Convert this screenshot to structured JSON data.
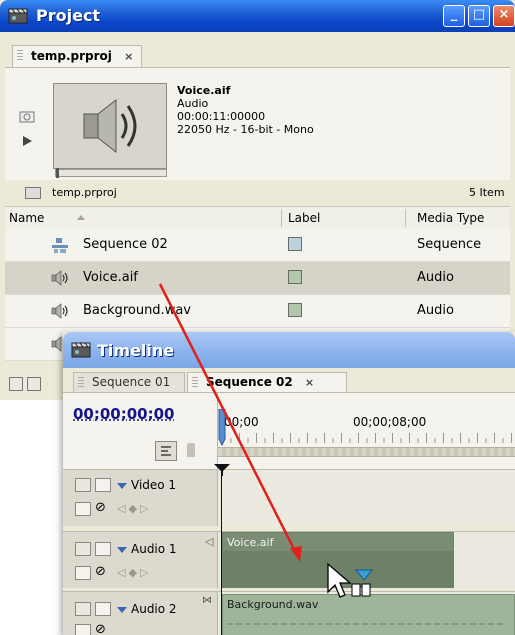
{
  "project": {
    "title": "Project",
    "tab": "temp.prproj",
    "tab_close": "×",
    "preview": {
      "name": "Voice.aif",
      "kind": "Audio",
      "duration": "00:00:11:00000",
      "format": "22050 Hz - 16-bit - Mono"
    },
    "bin": {
      "name": "temp.prproj",
      "items": "5 Item"
    },
    "columns": {
      "name": "Name",
      "label": "Label",
      "media_type": "Media Type"
    },
    "rows": [
      {
        "name": "Sequence 02",
        "type": "Sequence",
        "label_color": "#bcd2dc",
        "icon": "sequence-icon"
      },
      {
        "name": "Voice.aif",
        "type": "Audio",
        "label_color": "#b3c7ad",
        "icon": "speaker-icon",
        "selected": true
      },
      {
        "name": "Background.wav",
        "type": "Audio",
        "label_color": "#b3c7ad",
        "icon": "speaker-icon"
      }
    ]
  },
  "timeline": {
    "title": "Timeline",
    "tabs": [
      "Sequence 01",
      "Sequence 02"
    ],
    "tab_close": "×",
    "timecode": "00;00;00;00",
    "ruler_labels": [
      "00;00",
      "00;00;08;00"
    ],
    "tracks": [
      {
        "name": "Video 1"
      },
      {
        "name": "Audio 1",
        "clip": "Voice.aif"
      },
      {
        "name": "Audio 2",
        "clip": "Background.wav"
      }
    ]
  },
  "colors": {
    "title_active": "#0a46c8",
    "title_inactive": "#8fb5ee",
    "drag_arrow": "#e0201a",
    "timecode": "#14148c",
    "voice_clip": "#7b8c75",
    "bg_clip": "#9fb59a"
  }
}
